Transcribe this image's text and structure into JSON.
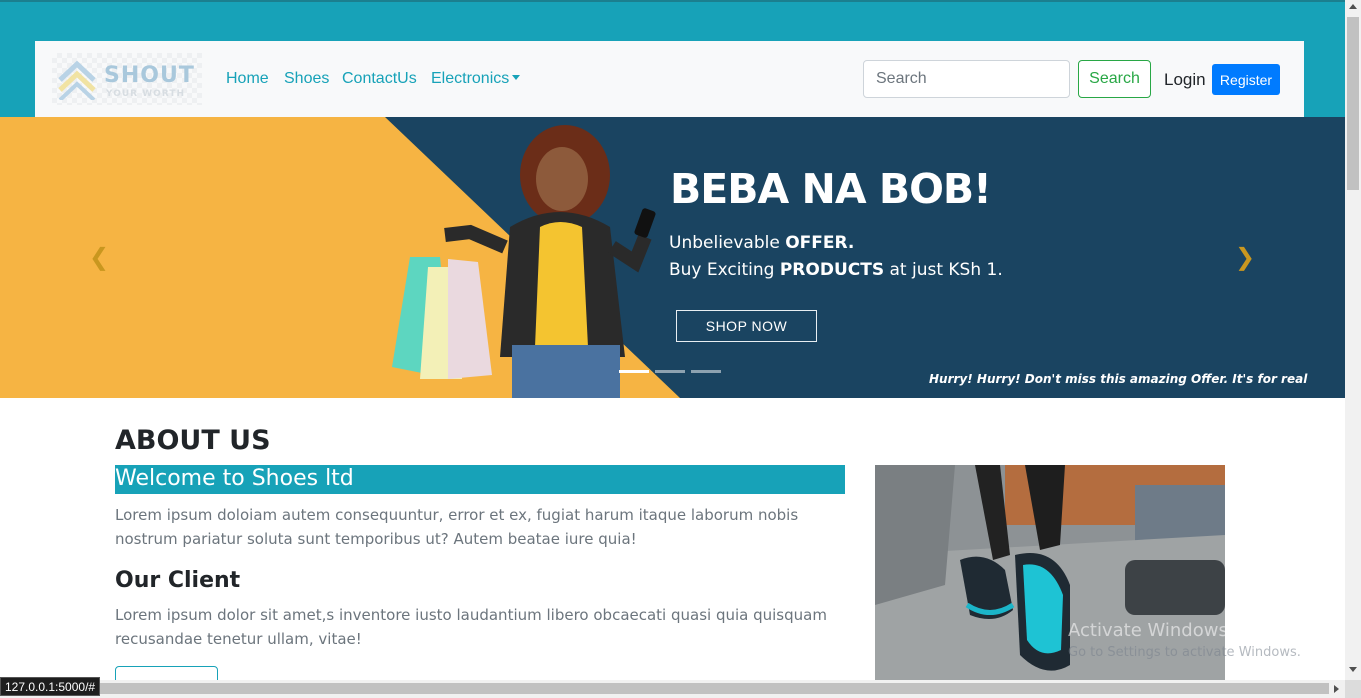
{
  "navbar": {
    "logo": {
      "brand": "SHOUT",
      "tagline": "YOUR WORTH"
    },
    "links": [
      "Home",
      "Shoes",
      "ContactUs",
      "Electronics"
    ],
    "search": {
      "placeholder": "Search",
      "button_label": "Search"
    },
    "login_label": "Login",
    "register_label": "Register"
  },
  "carousel": {
    "title": "BEBA NA BOB!",
    "line1_prefix": "Unbelievable ",
    "line1_bold": "OFFER.",
    "line2_prefix": "Buy Exciting ",
    "line2_bold": "PRODUCTS",
    "line2_suffix": " at just KSh 1.",
    "cta_label": "SHOP NOW",
    "footnote": "Hurry! Hurry! Don't miss this amazing Offer. It's for real",
    "prev_icon": "❮",
    "next_icon": "❯",
    "slide_count": 3,
    "active_slide": 1,
    "colors": {
      "yellow": "#f6b443",
      "navy": "#1a4461"
    }
  },
  "about": {
    "title": "ABOUT US",
    "welcome": "Welcome to Shoes ltd",
    "welcome_text": "Lorem ipsum doloiam autem consequuntur, error et ex, fugiat harum itaque laborum nobis nostrum pariatur soluta sunt temporibus ut? Autem beatae iure quia!",
    "client_title": "Our Client",
    "client_text": "Lorem ipsum dolor sit amet,s inventore iusto laudantium libero obcaecati quasi quia quisquam recusandae tenetur ullam, vitae!"
  },
  "watermark": {
    "line1": "Activate Windows",
    "line2": "Go to Settings to activate Windows."
  },
  "status_bar": {
    "url": "127.0.0.1:5000/#"
  },
  "colors": {
    "accent": "#17a2b8",
    "primary": "#007bff",
    "success": "#28a745"
  }
}
